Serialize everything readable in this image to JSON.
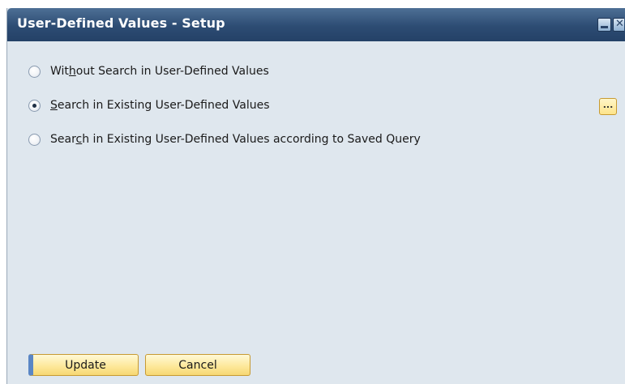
{
  "window": {
    "title": "User-Defined Values - Setup"
  },
  "options": [
    {
      "pre": "Wit",
      "mnemonic": "h",
      "post": "out Search in User-Defined Values",
      "checked": false
    },
    {
      "pre": "",
      "mnemonic": "S",
      "post": "earch in Existing User-Defined Values",
      "checked": true
    },
    {
      "pre": "Sear",
      "mnemonic": "c",
      "post": "h in Existing User-Defined Values according to Saved Query",
      "checked": false
    }
  ],
  "ellipsis_button": {
    "label": "..."
  },
  "buttons": {
    "update": "Update",
    "cancel": "Cancel"
  },
  "colors": {
    "titlebar": "#2d4c73",
    "body": "#dfe7ee",
    "button": "#fde797",
    "default_button_accent": "#5a86c5"
  }
}
